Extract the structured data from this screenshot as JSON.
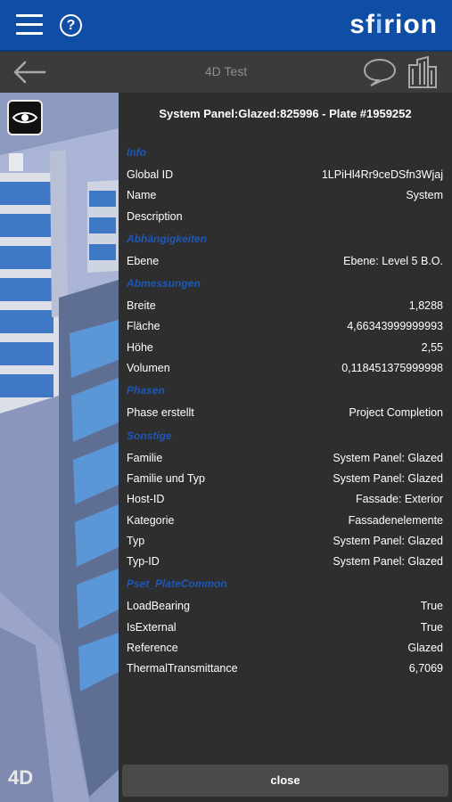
{
  "header": {
    "logo_text": "sfirion",
    "menu_icon": "menu-icon",
    "help_icon": "help-icon"
  },
  "nav": {
    "title": "4D Test",
    "back_icon": "arrow-left-icon",
    "comment_icon": "comment-icon",
    "building_icon": "building-icon"
  },
  "viewport": {
    "badge": "4D",
    "eye_icon": "eye-icon"
  },
  "panel": {
    "title": "System Panel:Glazed:825996 - Plate #1959252",
    "sections": [
      {
        "name": "Info",
        "rows": [
          {
            "key": "Global ID",
            "value": "1LPiHl4Rr9ceDSfn3Wjaj"
          },
          {
            "key": "Name",
            "value": "System"
          },
          {
            "key": "Description",
            "value": ""
          }
        ]
      },
      {
        "name": "Abhängigkeiten",
        "rows": [
          {
            "key": "Ebene",
            "value": "Ebene: Level 5  B.O."
          }
        ]
      },
      {
        "name": "Abmessungen",
        "rows": [
          {
            "key": "Breite",
            "value": "1,8288"
          },
          {
            "key": "Fläche",
            "value": "4,66343999999993"
          },
          {
            "key": "Höhe",
            "value": "2,55"
          },
          {
            "key": "Volumen",
            "value": "0,118451375999998"
          }
        ]
      },
      {
        "name": "Phasen",
        "rows": [
          {
            "key": "Phase erstellt",
            "value": "Project Completion"
          }
        ]
      },
      {
        "name": "Sonstige",
        "rows": [
          {
            "key": "Familie",
            "value": "System Panel: Glazed"
          },
          {
            "key": "Familie und Typ",
            "value": "System Panel: Glazed"
          },
          {
            "key": "Host-ID",
            "value": "Fassade: Exterior"
          },
          {
            "key": "Kategorie",
            "value": "Fassadenelemente"
          },
          {
            "key": "Typ",
            "value": "System Panel: Glazed"
          },
          {
            "key": "Typ-ID",
            "value": "System Panel: Glazed"
          }
        ]
      },
      {
        "name": "Pset_PlateCommon",
        "rows": [
          {
            "key": "LoadBearing",
            "value": "True"
          },
          {
            "key": "IsExternal",
            "value": "True"
          },
          {
            "key": "Reference",
            "value": "Glazed"
          },
          {
            "key": "ThermalTransmittance",
            "value": "6,7069"
          }
        ]
      }
    ],
    "close_label": "close"
  },
  "colors": {
    "brand_blue": "#0f4ea4",
    "section_blue": "#1d58b8",
    "panel_bg": "#2e2e2e"
  }
}
